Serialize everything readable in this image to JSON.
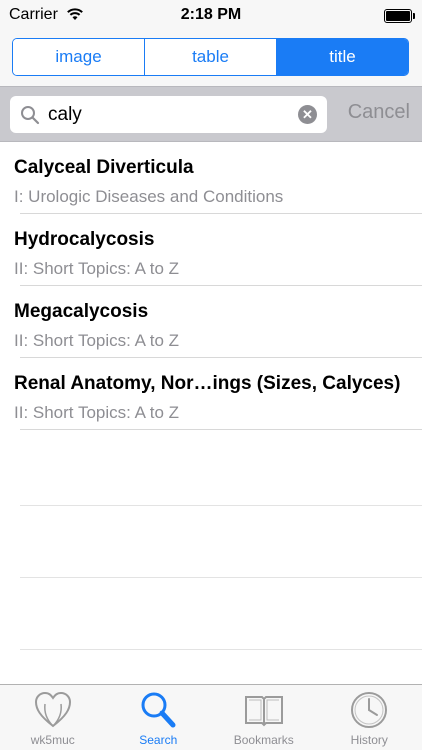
{
  "status_bar": {
    "carrier": "Carrier",
    "time": "2:18 PM"
  },
  "segments": [
    {
      "label": "image",
      "selected": false
    },
    {
      "label": "table",
      "selected": false
    },
    {
      "label": "title",
      "selected": true
    }
  ],
  "search": {
    "value": "caly",
    "cancel_label": "Cancel"
  },
  "results": [
    {
      "title": "Calyceal Diverticula",
      "subtitle": "I: Urologic Diseases and Conditions"
    },
    {
      "title": "Hydrocalycosis",
      "subtitle": "II: Short Topics: A to Z"
    },
    {
      "title": "Megacalycosis",
      "subtitle": "II: Short Topics: A to Z"
    },
    {
      "title": "Renal Anatomy, Nor…ings (Sizes, Calyces)",
      "subtitle": "II: Short Topics: A to Z"
    }
  ],
  "tab_bar": {
    "active": "Search",
    "tabs": [
      {
        "label": "wk5muc",
        "icon": "heart-icon"
      },
      {
        "label": "Search",
        "icon": "search-icon"
      },
      {
        "label": "Bookmarks",
        "icon": "book-icon"
      },
      {
        "label": "History",
        "icon": "clock-icon"
      }
    ]
  },
  "colors": {
    "accent": "#1a7cf5",
    "secondary_text": "#8e8e93",
    "search_bar_bg": "#c9c9ce"
  }
}
